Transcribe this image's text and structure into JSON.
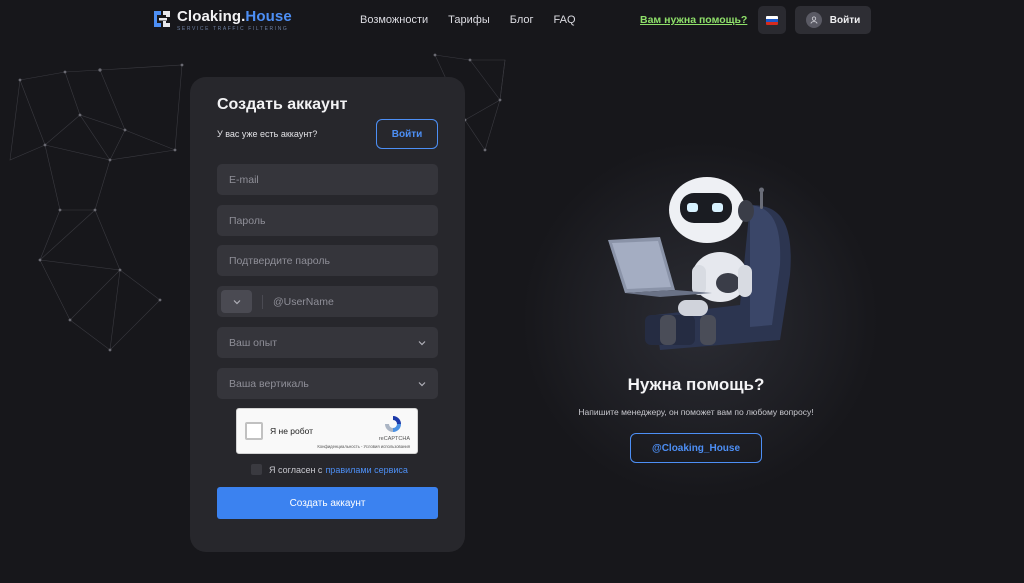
{
  "header": {
    "logo": {
      "name_main": "Cloaking.",
      "name_accent": "House",
      "tagline": "SERVICE TRAFFIC FILTERING"
    },
    "nav": [
      "Возможности",
      "Тарифы",
      "Блог",
      "FAQ"
    ],
    "help_link": "Вам нужна помощь?",
    "login_label": "Войти"
  },
  "form": {
    "title": "Создать аккаунт",
    "have_account": "У вас уже есть аккаунт?",
    "login_button": "Войти",
    "email_placeholder": "E-mail",
    "password_placeholder": "Пароль",
    "confirm_placeholder": "Подтвердите пароль",
    "username_placeholder": "@UserName",
    "experience_placeholder": "Ваш опыт",
    "vertical_placeholder": "Ваша вертикаль",
    "captcha": {
      "label": "Я не робот",
      "brand": "reCAPTCHA",
      "links": "Конфиденциальность - Условия использования"
    },
    "agree_text": "Я согласен с",
    "agree_link": "правилами сервиса",
    "submit": "Создать аккаунт"
  },
  "help": {
    "title": "Нужна помощь?",
    "subtitle": "Напишите менеджеру, он поможет вам по любому вопросу!",
    "contact_button": "@Cloaking_House"
  },
  "colors": {
    "background": "#17171b",
    "card": "#27272c",
    "accent": "#4d8ff5",
    "help_link": "#8fe06a"
  },
  "icons": [
    "logo-icon",
    "russia-flag-icon",
    "user-icon",
    "chevron-down-icon",
    "recaptcha-icon",
    "robot-illustration"
  ]
}
